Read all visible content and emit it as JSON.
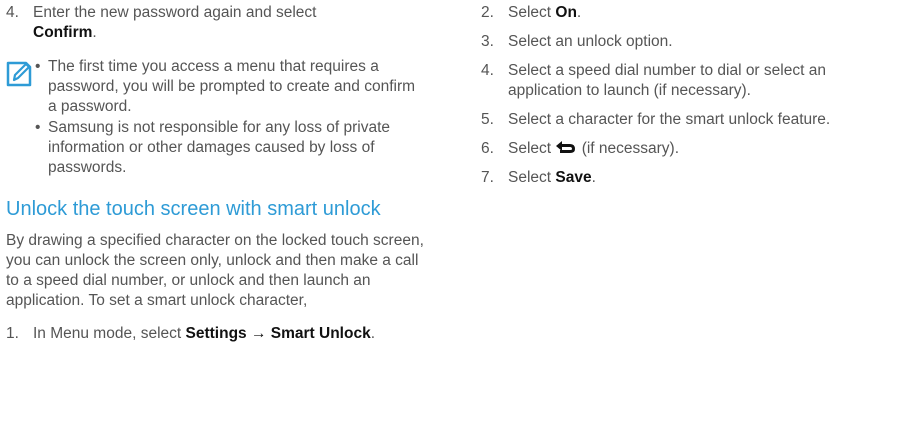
{
  "left": {
    "step4": {
      "num": "4.",
      "text": "Enter the new password again and select",
      "bold": "Confirm",
      "after": "."
    },
    "note": {
      "icon": "note-pencil-icon",
      "bullets": [
        "The first time you access a menu that requires a password, you will be prompted to create and confirm a password.",
        "Samsung is not responsible for any loss of private information or other damages caused by loss of passwords."
      ],
      "bullet_char": "•"
    },
    "heading": "Unlock the touch screen with smart unlock",
    "paragraph": "By drawing a specified character on the locked touch screen, you can unlock the screen only, unlock and then make a call to a speed dial number, or unlock and then launch an application. To set a smart unlock character,",
    "step1": {
      "num": "1.",
      "text": "In Menu mode, select",
      "bold": "Settings → Smart Unlock",
      "after": "."
    }
  },
  "right": {
    "steps": [
      {
        "num": "2.",
        "pre": "Select ",
        "bold": "On",
        "post": "."
      },
      {
        "num": "3.",
        "pre": "Select an unlock option.",
        "bold": "",
        "post": ""
      },
      {
        "num": "4.",
        "pre": "Select a speed dial number to dial or select an application to launch (if necessary).",
        "bold": "",
        "post": ""
      },
      {
        "num": "5.",
        "pre": "Select a character for the smart unlock feature.",
        "bold": "",
        "post": ""
      },
      {
        "num": "6.",
        "pre": "Select ",
        "icon": "back-arrow-icon",
        "bold": "",
        "post": " (if necessary)."
      },
      {
        "num": "7.",
        "pre": "Select ",
        "bold": "Save",
        "post": "."
      }
    ]
  }
}
